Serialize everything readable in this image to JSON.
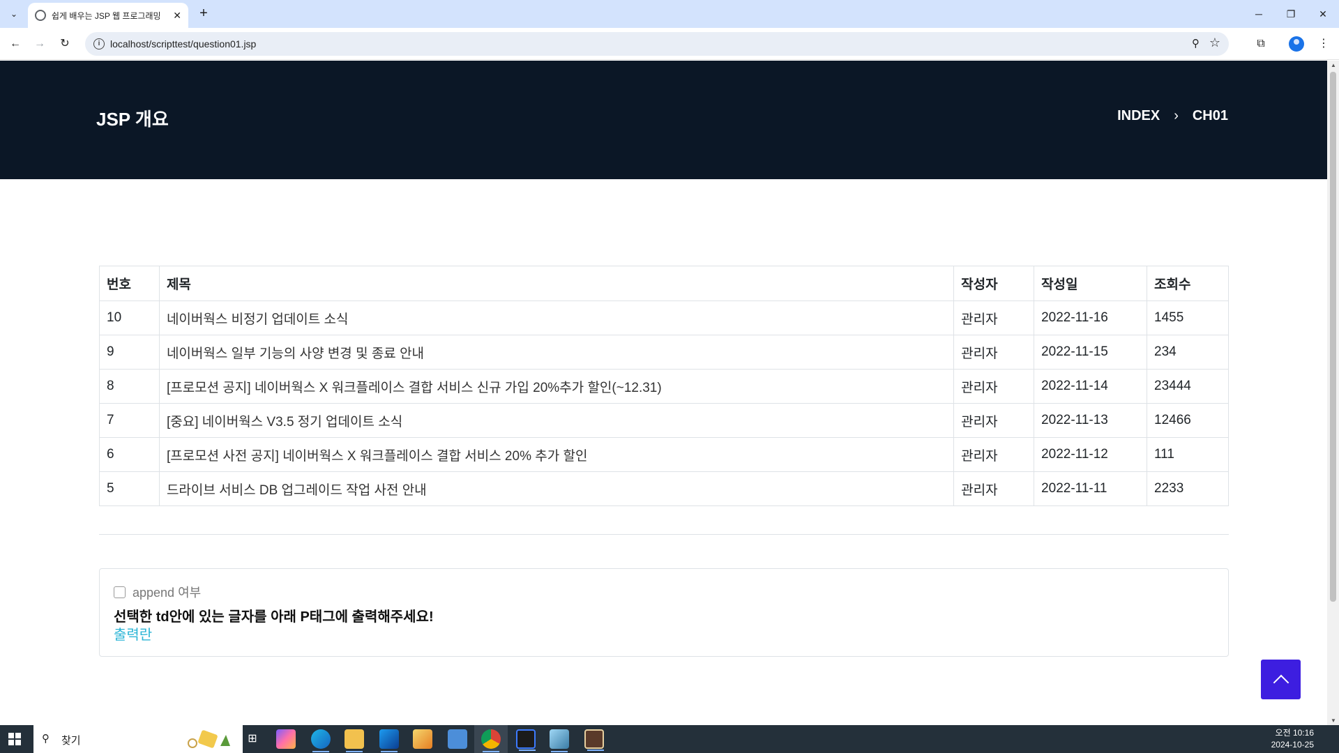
{
  "browser": {
    "tab_title": "쉽게 배우는 JSP 웹 프로그래밍",
    "tab_close": "✕",
    "new_tab": "+",
    "url": "localhost/scripttest/question01.jsp",
    "window_controls": {
      "minimize": "─",
      "restore": "❐",
      "close": "✕"
    }
  },
  "page": {
    "title": "JSP 개요",
    "breadcrumb": {
      "home": "INDEX",
      "separator": "›",
      "current": "CH01"
    }
  },
  "board": {
    "headers": {
      "no": "번호",
      "title": "제목",
      "author": "작성자",
      "date": "작성일",
      "views": "조회수"
    },
    "rows": [
      {
        "no": "10",
        "title": "네이버웍스 비정기 업데이트 소식",
        "author": "관리자",
        "date": "2022-11-16",
        "views": "1455"
      },
      {
        "no": "9",
        "title": "네이버웍스 일부 기능의 사양 변경 및 종료 안내",
        "author": "관리자",
        "date": "2022-11-15",
        "views": "234"
      },
      {
        "no": "8",
        "title": "[프로모션 공지] 네이버웍스 X 워크플레이스 결합 서비스 신규 가입 20%추가 할인(~12.31)",
        "author": "관리자",
        "date": "2022-11-14",
        "views": "23444"
      },
      {
        "no": "7",
        "title": "[중요] 네이버웍스 V3.5 정기 업데이트 소식",
        "author": "관리자",
        "date": "2022-11-13",
        "views": "12466"
      },
      {
        "no": "6",
        "title": "[프로모션 사전 공지] 네이버웍스 X 워크플레이스 결합 서비스 20% 추가 할인",
        "author": "관리자",
        "date": "2022-11-12",
        "views": "111"
      },
      {
        "no": "5",
        "title": "드라이브 서비스 DB 업그레이드 작업 사전 안내",
        "author": "관리자",
        "date": "2022-11-11",
        "views": "2233"
      }
    ]
  },
  "panel": {
    "append_label": "append 여부",
    "instruction": "선택한 td안에 있는 글자를 아래 P태그에 출력해주세요!",
    "output_text": "출력란"
  },
  "taskbar": {
    "search_placeholder": "찾기",
    "clock_time": "오전 10:16",
    "clock_date": "2024-10-25"
  },
  "colors": {
    "hero_bg": "#0b1726",
    "output_text": "#2bb5d6",
    "scroll_top_button": "#3d1ee0",
    "tab_strip": "#d3e3fd"
  }
}
